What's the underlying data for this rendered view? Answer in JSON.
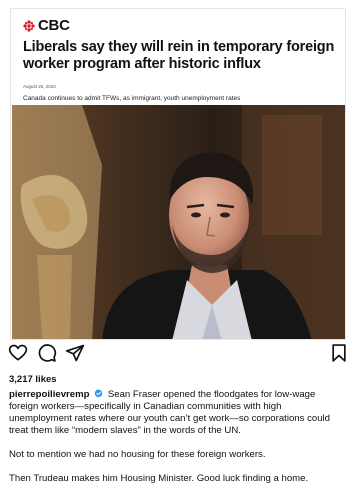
{
  "post": {
    "brand": "CBC",
    "headline": "Liberals say they will rein in temporary foreign worker program after historic influx",
    "date": "August 26, 2024",
    "subheadline": "Canada continues to admit TFWs, as immigrant, youth unemployment rates",
    "photo_icon": "news-photo"
  },
  "actions": {
    "like_icon": "heart-icon",
    "comment_icon": "comment-icon",
    "share_icon": "send-icon",
    "save_icon": "bookmark-icon"
  },
  "likes": "3,217 likes",
  "caption": {
    "username": "pierrepoilievremp",
    "text": "Sean Fraser opened the floodgates for low-wage foreign workers—specifically in Canadian communities with high unemployment rates where our youth can’t get work—so corporations could treat them like “modern slaves” in the words of the UN.",
    "paragraph_2": "Not to mention we had no housing for these foreign workers.",
    "paragraph_3": "Then Trudeau makes him Housing Minister. Good luck finding a home."
  },
  "colors": {
    "brand_red": "#d71920",
    "verified_blue": "#3897f0"
  }
}
